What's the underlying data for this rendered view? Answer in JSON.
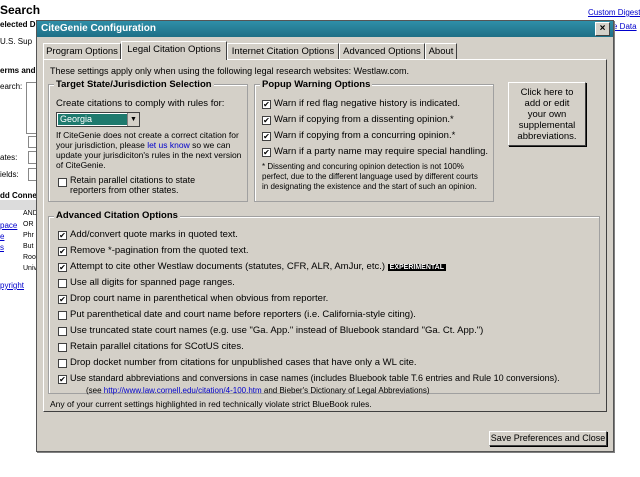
{
  "background": {
    "title": "Search",
    "top_right_link_1": "Custom Digest",
    "top_right_link_2": "e Data",
    "selected": "elected D",
    "us_sup": "U.S. Sup",
    "terms": "erms and",
    "search_label": "earch:",
    "states_label": "ates:",
    "fields_label": "ields:",
    "add_conn": "dd Conne",
    "connectors": [
      "AND",
      "OR",
      "Phr",
      "But",
      "Roo",
      "Univ"
    ],
    "side_links": [
      "pace",
      "e",
      "s"
    ],
    "copyright": "pyright"
  },
  "window": {
    "title": "CiteGenie Configuration",
    "close_glyph": "×",
    "tabs": [
      {
        "label": "Program Options"
      },
      {
        "label": "Legal Citation Options"
      },
      {
        "label": "Internet Citation Options"
      },
      {
        "label": "Advanced Options"
      },
      {
        "label": "About"
      }
    ],
    "intro": "These settings apply only when using the following legal research websites: Westlaw.com.",
    "target": {
      "label": "Target State/Jurisdiction Selection",
      "comply": "Create citations to comply with rules for:",
      "selected_state": "Georgia",
      "dropdown_glyph": "▼",
      "help_1": "If CiteGenie does not create a correct citation for",
      "help_2_pre": "your jurisdiction, please ",
      "help_2_link": "let us know",
      "help_2_post": " so we can",
      "help_3": "update your jurisdiciton's rules in the next version",
      "help_4": "of CiteGenie.",
      "retain_1": "Retain parallel citations to state",
      "retain_2": "reporters from other states."
    },
    "popup": {
      "label": "Popup Warning Options",
      "items": [
        "Warn if red flag negative history is indicated.",
        "Warn if copying from a dissenting opinion.*",
        "Warn if copying from a concurring opinion.*",
        "Warn if a party name may require special handling."
      ],
      "note_1": "* Dissenting and concuring opinion detection is not 100%",
      "note_2": "perfect, due to the different language used by different courts",
      "note_3": "in designating the existence and the start of such an opinion."
    },
    "abbrev_button": [
      "Click here to",
      "add or edit",
      "your own",
      "supplemental",
      "abbreviations."
    ],
    "advanced": {
      "label": "Advanced Citation Options",
      "items": [
        {
          "text": "Add/convert quote marks in quoted text.",
          "checked": "✔"
        },
        {
          "text": "Remove *-pagination from the quoted text.",
          "checked": "✔"
        },
        {
          "text": "Attempt to cite other Westlaw documents (statutes, CFR, ALR, AmJur, etc.)",
          "checked": "✔",
          "badge": "EXPERIMENTAL"
        },
        {
          "text": "Use all digits for spanned page ranges.",
          "checked": ""
        },
        {
          "text": "Drop court name in parenthetical when obvious from reporter.",
          "checked": "✔"
        },
        {
          "text": "Put parenthetical date and court name before reporters (i.e. California-style citing).",
          "checked": ""
        },
        {
          "text": "Use truncated state court names (e.g. use \"Ga. App.\" instead of Bluebook standard \"Ga. Ct. App.\")",
          "checked": ""
        },
        {
          "text": "Retain parallel citations for SCotUS cites.",
          "checked": ""
        },
        {
          "text": "Drop docket number from citations for unpublished cases that have only a WL cite.",
          "checked": ""
        },
        {
          "text": "Use standard abbreviations and conversions in case names (includes Bluebook table T.6 entries and Rule 10 conversions).",
          "checked": "✔"
        }
      ],
      "see_pre": "(see ",
      "see_link": "http://www.law.cornell.edu/citation/4-100.htm",
      "see_post": " and Bieber's Dictionary of Legal Abbreviations)"
    },
    "footer_note": "Any of your current settings highlighted in red technically violate strict BlueBook rules.",
    "save_button": "Save Preferences and Close"
  }
}
